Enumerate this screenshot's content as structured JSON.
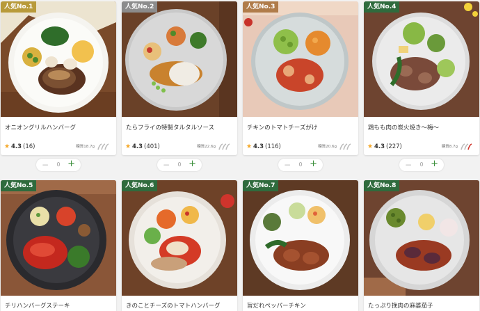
{
  "cards": [
    {
      "rank": "人気No.1",
      "name": "オニオングリルハンバーグ",
      "rating": "4.3",
      "count": "(16)",
      "carb": "糖質18.7g",
      "spicy_icon": "pepper-icon-gray",
      "qty": "0",
      "rank_color": "#b89a3a"
    },
    {
      "rank": "人気No.2",
      "name": "たらフライの特製タルタルソース",
      "rating": "4.3",
      "count": "(401)",
      "carb": "糖質22.6g",
      "spicy_icon": "pepper-icon-gray",
      "qty": "0",
      "rank_color": "#8c8c8c"
    },
    {
      "rank": "人気No.3",
      "name": "チキンのトマトチーズがけ",
      "rating": "4.3",
      "count": "(116)",
      "carb": "糖質20.6g",
      "spicy_icon": "pepper-icon-gray",
      "qty": "0",
      "rank_color": "#b07c4a"
    },
    {
      "rank": "人気No.4",
      "name": "鶏もも肉の炭火焼き～梅～",
      "rating": "4.3",
      "count": "(227)",
      "carb": "糖質8.7g",
      "spicy_icon": "pepper-icon-red",
      "qty": "0",
      "rank_color": "#2f6b3d"
    },
    {
      "rank": "人気No.5",
      "name": "チリハンバーグステーキ",
      "rank_color": "#2f6b3d"
    },
    {
      "rank": "人気No.6",
      "name": "きのことチーズのトマトハンバーグ",
      "rank_color": "#2f6b3d"
    },
    {
      "rank": "人気No.7",
      "name": "旨だれペッパーチキン",
      "rank_color": "#2f6b3d"
    },
    {
      "rank": "人気No.8",
      "name": "たっぷり挽肉の麻婆茄子",
      "rank_color": "#2f6b3d"
    }
  ],
  "colors": {
    "accent": "#3a8e3a",
    "star": "#f5a623",
    "spicy_red": "#d0342c"
  }
}
